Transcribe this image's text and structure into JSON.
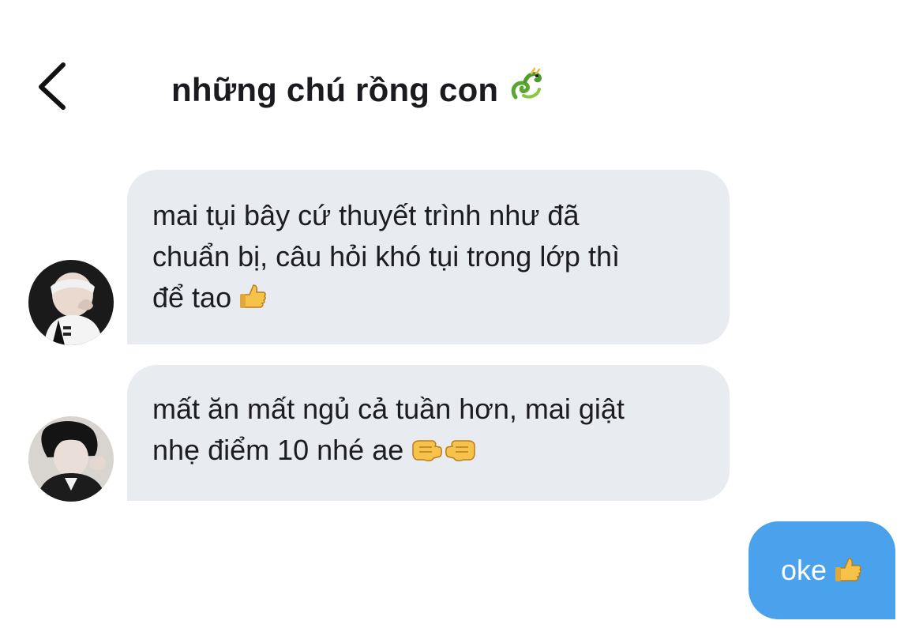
{
  "header": {
    "title": "những chú rồng con",
    "title_emoji": "dragon-icon",
    "back_icon": "chevron-left-icon"
  },
  "messages": [
    {
      "sender": "other",
      "text": "mai tụi bây cứ thuyết trình như đã\nchuẩn bị, câu hỏi khó tụi trong lớp thì\nđể tao",
      "emoji": [
        "thumbs-up-icon"
      ]
    },
    {
      "sender": "other",
      "text": "mất ăn mất ngủ cả tuần hơn, mai giật\nnhẹ điểm 10 nhé ae",
      "emoji": [
        "left-facing-fist-icon",
        "right-facing-fist-icon"
      ]
    },
    {
      "sender": "me",
      "text": "oke",
      "emoji": [
        "thumbs-up-icon"
      ]
    }
  ],
  "colors": {
    "incoming_bubble": "#e8ebf0",
    "outgoing_bubble": "#4aa1ec",
    "text": "#1c1c22",
    "background": "#ffffff"
  }
}
